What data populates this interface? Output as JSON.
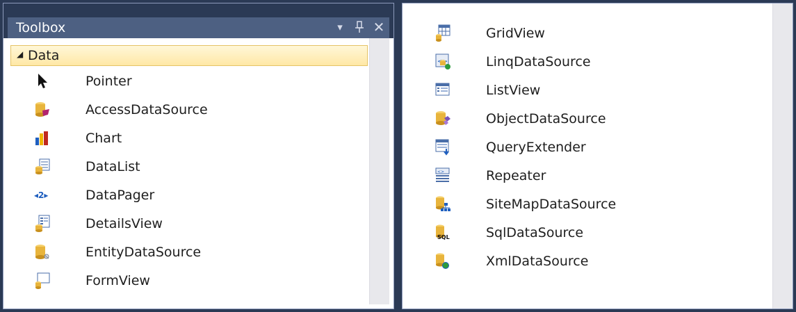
{
  "toolbox": {
    "title": "Toolbox",
    "dropdown_glyph": "▾",
    "pin_glyph": "ᵖ",
    "close_glyph": "✕",
    "group": {
      "arrow": "◢",
      "label": "Data"
    }
  },
  "left_items": [
    {
      "label": "Pointer",
      "icon": "pointer-icon"
    },
    {
      "label": "AccessDataSource",
      "icon": "access-datasource-icon"
    },
    {
      "label": "Chart",
      "icon": "chart-icon"
    },
    {
      "label": "DataList",
      "icon": "datalist-icon"
    },
    {
      "label": "DataPager",
      "icon": "datapager-icon",
      "glyph": "◂2▸"
    },
    {
      "label": "DetailsView",
      "icon": "detailsview-icon"
    },
    {
      "label": "EntityDataSource",
      "icon": "entity-datasource-icon"
    },
    {
      "label": "FormView",
      "icon": "formview-icon"
    }
  ],
  "right_items": [
    {
      "label": "GridView",
      "icon": "gridview-icon"
    },
    {
      "label": "LinqDataSource",
      "icon": "linq-datasource-icon"
    },
    {
      "label": "ListView",
      "icon": "listview-icon"
    },
    {
      "label": "ObjectDataSource",
      "icon": "object-datasource-icon"
    },
    {
      "label": "QueryExtender",
      "icon": "queryextender-icon"
    },
    {
      "label": "Repeater",
      "icon": "repeater-icon"
    },
    {
      "label": "SiteMapDataSource",
      "icon": "sitemap-datasource-icon"
    },
    {
      "label": "SqlDataSource",
      "icon": "sql-datasource-icon",
      "glyph": "SQL"
    },
    {
      "label": "XmlDataSource",
      "icon": "xml-datasource-icon"
    }
  ],
  "colors": {
    "frame": "#2b3a55",
    "titlebar": "#4d6082",
    "group_highlight": "#ffe8a6",
    "db_gold": "#e8b43c"
  }
}
